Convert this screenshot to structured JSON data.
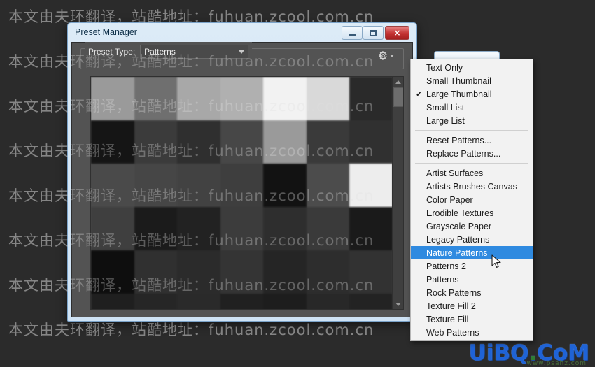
{
  "window": {
    "title": "Preset Manager",
    "controls": [
      {
        "name": "minimize",
        "glyph": "minimize-icon"
      },
      {
        "name": "maximize",
        "glyph": "maximize-icon"
      },
      {
        "name": "close",
        "glyph": "×"
      }
    ]
  },
  "preset_bar": {
    "label": "Preset Type:",
    "combo_value": "Patterns",
    "gear_icon": "gear-icon",
    "caret_icon": "chevron-down-icon"
  },
  "menu": {
    "items": [
      {
        "label": "Text Only",
        "checked": false,
        "selected": false
      },
      {
        "label": "Small Thumbnail",
        "checked": false,
        "selected": false
      },
      {
        "label": "Large Thumbnail",
        "checked": true,
        "selected": false
      },
      {
        "label": "Small List",
        "checked": false,
        "selected": false
      },
      {
        "label": "Large List",
        "checked": false,
        "selected": false
      },
      {
        "separator": true
      },
      {
        "label": "Reset Patterns...",
        "checked": false,
        "selected": false
      },
      {
        "label": "Replace Patterns...",
        "checked": false,
        "selected": false
      },
      {
        "separator": true
      },
      {
        "label": "Artist Surfaces",
        "checked": false,
        "selected": false
      },
      {
        "label": "Artists Brushes Canvas",
        "checked": false,
        "selected": false
      },
      {
        "label": "Color Paper",
        "checked": false,
        "selected": false
      },
      {
        "label": "Erodible Textures",
        "checked": false,
        "selected": false
      },
      {
        "label": "Grayscale Paper",
        "checked": false,
        "selected": false
      },
      {
        "label": "Legacy Patterns",
        "checked": false,
        "selected": false
      },
      {
        "label": "Nature Patterns",
        "checked": false,
        "selected": true
      },
      {
        "label": "Patterns 2",
        "checked": false,
        "selected": false
      },
      {
        "label": "Patterns",
        "checked": false,
        "selected": false
      },
      {
        "label": "Rock Patterns",
        "checked": false,
        "selected": false
      },
      {
        "label": "Texture Fill 2",
        "checked": false,
        "selected": false
      },
      {
        "label": "Texture Fill",
        "checked": false,
        "selected": false
      },
      {
        "label": "Web Patterns",
        "checked": false,
        "selected": false
      }
    ],
    "check_glyph": "✔",
    "highlight_color": "#2f8ae0"
  },
  "grid": {
    "columns": 7,
    "swatches": [
      "#9a9a9a",
      "#6f6f6f",
      "#a8a8a8",
      "#b0b0b0",
      "#f2f2f2",
      "#d9d9d9",
      "#2a2a2a",
      "#151515",
      "#3b3b3b",
      "#2f2f2f",
      "#474747",
      "#9a9a9a",
      "#3a3a3a",
      "#303030",
      "#4a4a4a",
      "#464646",
      "#424242",
      "#3e3e3e",
      "#121212",
      "#4c4c4c",
      "#ededed",
      "#3f3f3f",
      "#1b1b1b",
      "#222222",
      "#3c3c3c",
      "#2e2e2e",
      "#3a3a3a",
      "#1a1a1a",
      "#0e0e0e",
      "#303030",
      "#2b2b2b",
      "#343434",
      "#252525",
      "#2d2d2d",
      "#323232",
      "#1f1f1f",
      "#262626",
      "#2a2a2a",
      "#202020",
      "#1d1d1d",
      "#282828",
      "#232323"
    ]
  },
  "scrollbar": {
    "up_icon": "chevron-up-icon",
    "down_icon": "chevron-down-icon",
    "thumb": "scroll-thumb"
  },
  "watermark": {
    "text": "本文由夫环翻译，站酷地址：fuhuan.zcool.com.cn",
    "rows": 8
  },
  "logo": {
    "text_a": "UiBQ",
    "text_dot": ".",
    "text_b": "CoM",
    "subtext": "www.psahz.com"
  }
}
